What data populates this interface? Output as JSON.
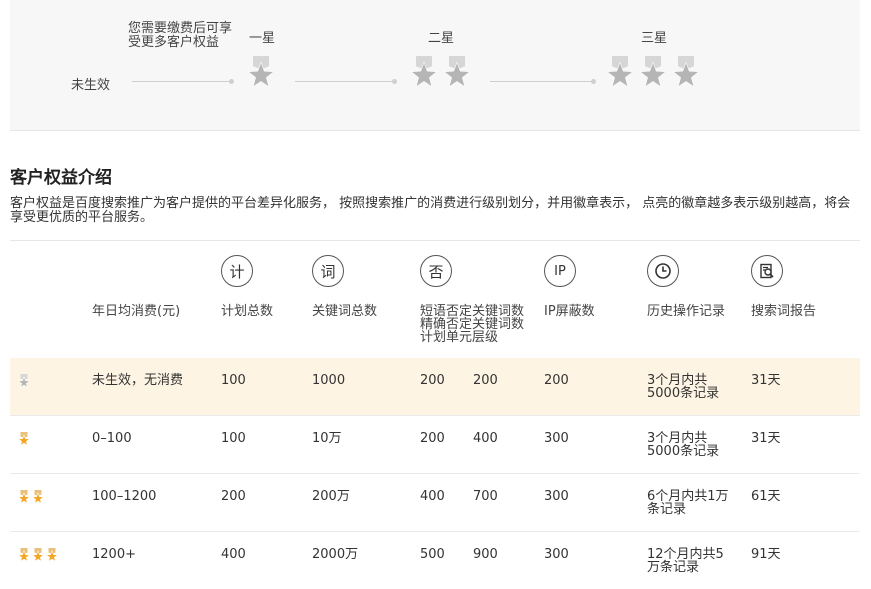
{
  "timeline": {
    "promo": "您需要缴费后可享受更多客户权益",
    "inactive_label": "未生效",
    "levels": [
      {
        "name": "一星",
        "stars": 1
      },
      {
        "name": "二星",
        "stars": 2
      },
      {
        "name": "三星",
        "stars": 3
      }
    ]
  },
  "section": {
    "title": "客户权益介绍",
    "intro": "客户权益是百度搜索推广为客户提供的平台差异化服务， 按照搜索推广的消费进行级别划分，并用徽章表示， 点亮的徽章越多表示级别越高，将会享受更优质的平台服务。"
  },
  "table": {
    "columns": [
      {
        "key": "spend",
        "label": "年日均消费(元)",
        "icon": ""
      },
      {
        "key": "plans",
        "label": "计划总数",
        "icon": "计"
      },
      {
        "key": "keywords",
        "label": "关键词总数",
        "icon": "词"
      },
      {
        "key": "negatives",
        "label": "短语否定关键词数精确否定关键词数计划单元层级",
        "icon": "否"
      },
      {
        "key": "ip",
        "label": "IP屏蔽数",
        "icon": "IP"
      },
      {
        "key": "history",
        "label": "历史操作记录",
        "icon": "clock-icon"
      },
      {
        "key": "report",
        "label": "搜索词报告",
        "icon": "report-icon"
      }
    ],
    "rows": [
      {
        "stars": 1,
        "lit": 0,
        "spend": "未生效，无消费",
        "plans": "100",
        "keywords": "1000",
        "neg_phrase": "200",
        "neg_exact": "200",
        "ip": "200",
        "history": "3个月内共5000条记录",
        "report": "31天"
      },
      {
        "stars": 1,
        "lit": 1,
        "spend": "0–100",
        "plans": "100",
        "keywords": "10万",
        "neg_phrase": "200",
        "neg_exact": "400",
        "ip": "300",
        "history": "3个月内共5000条记录",
        "report": "31天"
      },
      {
        "stars": 2,
        "lit": 2,
        "spend": "100–1200",
        "plans": "200",
        "keywords": "200万",
        "neg_phrase": "400",
        "neg_exact": "700",
        "ip": "300",
        "history": "6个月内共1万条记录",
        "report": "61天"
      },
      {
        "stars": 3,
        "lit": 3,
        "spend": "1200+",
        "plans": "400",
        "keywords": "2000万",
        "neg_phrase": "500",
        "neg_exact": "900",
        "ip": "300",
        "history": "12个月内共5万条记录",
        "report": "91天"
      }
    ]
  },
  "colors": {
    "medal_gray": "#b5b5b5",
    "medal_gold": "#f5a623",
    "highlight": "#fdf4e3"
  }
}
